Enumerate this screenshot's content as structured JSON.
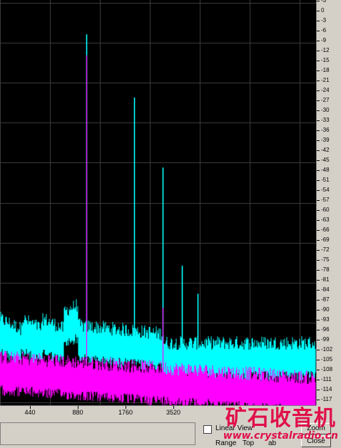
{
  "chart_data": {
    "type": "line",
    "x_scale": "log",
    "x_ticks": [
      "440",
      "880",
      "1760",
      "3520"
    ],
    "y_ticks": [
      "-3",
      "0",
      "-3",
      "-6",
      "-9",
      "-12",
      "-15",
      "-18",
      "-21",
      "-24",
      "-27",
      "-30",
      "-33",
      "-36",
      "-39",
      "-42",
      "-45",
      "-48",
      "-51",
      "-54",
      "-57",
      "-60",
      "-63",
      "-66",
      "-69",
      "-72",
      "-75",
      "-78",
      "-81",
      "-84",
      "-87",
      "-90",
      "-93",
      "-96",
      "-99",
      "-102",
      "-105",
      "-108",
      "-111",
      "-114",
      "-117"
    ],
    "ylim": [
      -117,
      -3
    ],
    "grid": true,
    "series": [
      {
        "color": "#00ffff",
        "noise_floor_db": -104,
        "peaks": [
          {
            "freq": 1000,
            "db": -12
          },
          {
            "freq": 2000,
            "db": -30
          },
          {
            "freq": 3000,
            "db": -50
          },
          {
            "freq": 4000,
            "db": -78
          },
          {
            "freq": 5000,
            "db": -86
          }
        ]
      },
      {
        "color": "#ff00ff",
        "noise_floor_db": -112,
        "peaks": [
          {
            "freq": 1000,
            "db": -18
          },
          {
            "freq": 3000,
            "db": -90
          }
        ]
      }
    ]
  },
  "controls": {
    "linear_view_label": "Linear View",
    "range_label": "Range",
    "top_label": "Top",
    "tab_label": "ab",
    "close_label": "Close",
    "zoom_label": "Zoom"
  },
  "watermark": {
    "title": "矿石收音机",
    "url": "www.crystalradio.cn"
  }
}
